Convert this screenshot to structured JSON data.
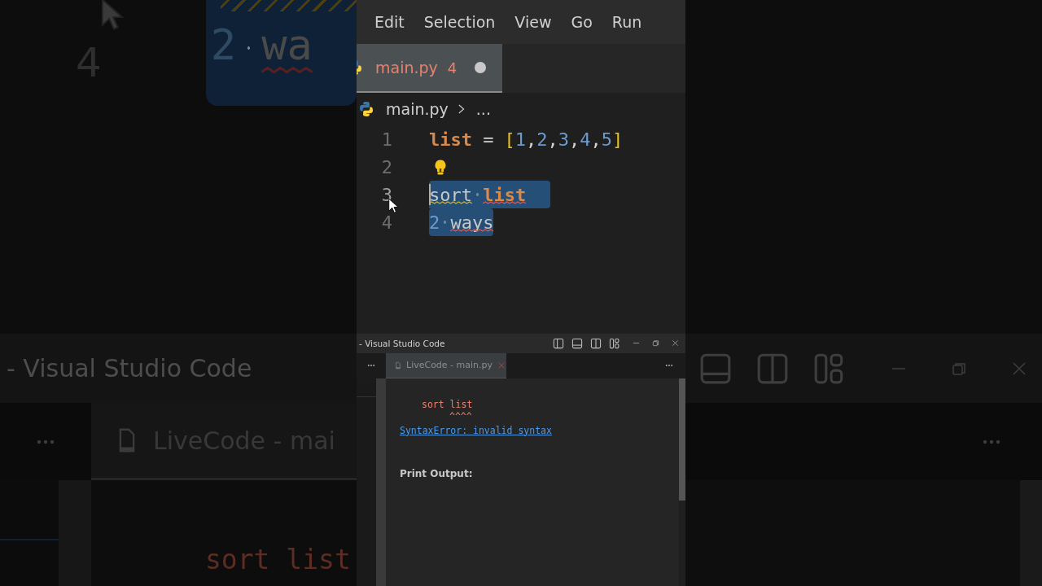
{
  "backdrop_left": {
    "line_number": "4",
    "code_tokens": [
      {
        "text": "2",
        "kind": "number"
      },
      {
        "kind": "space"
      },
      {
        "text": "wa",
        "kind": "plain",
        "squiggle": {
          "color": "#5a2020"
        }
      }
    ],
    "window_title": "- Visual Studio Code",
    "tab_label": "LiveCode - mai",
    "output_line": "sort list"
  },
  "menu": [
    "Edit",
    "Selection",
    "View",
    "Go",
    "Run"
  ],
  "editor_tab": {
    "label": "main.py",
    "problems": "4",
    "modified": true,
    "selected": true
  },
  "breadcrumb": {
    "file": "main.py",
    "rest": "..."
  },
  "code": [
    {
      "number": "1",
      "selected": false,
      "cursor": false,
      "lightbulb": false,
      "tokens": [
        {
          "text": "list",
          "kind": "variable"
        },
        {
          "kind": "space"
        },
        {
          "text": "=",
          "kind": "operator"
        },
        {
          "kind": "space"
        },
        {
          "text": "[",
          "kind": "bracket"
        },
        {
          "text": "1",
          "kind": "number"
        },
        {
          "text": ",",
          "kind": "punct"
        },
        {
          "text": "2",
          "kind": "number"
        },
        {
          "text": ",",
          "kind": "punct"
        },
        {
          "text": "3",
          "kind": "number"
        },
        {
          "text": ",",
          "kind": "punct"
        },
        {
          "text": "4",
          "kind": "number"
        },
        {
          "text": ",",
          "kind": "punct"
        },
        {
          "text": "5",
          "kind": "number"
        },
        {
          "text": "]",
          "kind": "bracket"
        }
      ]
    },
    {
      "number": "2",
      "selected": false,
      "cursor": false,
      "lightbulb": true
    },
    {
      "number": "3",
      "selected": true,
      "cursor": true,
      "lightbulb": false,
      "tokens": [
        {
          "text": "sort",
          "kind": "plain",
          "squiggle": {
            "color": "#c8b430"
          }
        },
        {
          "kind": "space"
        },
        {
          "text": "list",
          "kind": "variable",
          "squiggle": {
            "color": "#e05555"
          }
        }
      ]
    },
    {
      "number": "4",
      "selected": true,
      "cursor": false,
      "lightbulb": false,
      "tokens": [
        {
          "text": "2",
          "kind": "number"
        },
        {
          "kind": "space"
        },
        {
          "text": "ways",
          "kind": "plain",
          "squiggle": {
            "color": "#e05555"
          }
        }
      ]
    }
  ],
  "window_title": "- Visual Studio Code",
  "panel_tab": {
    "label": "LiveCode - main.py",
    "selected": true
  },
  "output": {
    "error_line": "sort list",
    "caret_marks": "^^^^",
    "error_link": "SyntaxError: invalid syntax",
    "print_heading": "Print Output:"
  }
}
